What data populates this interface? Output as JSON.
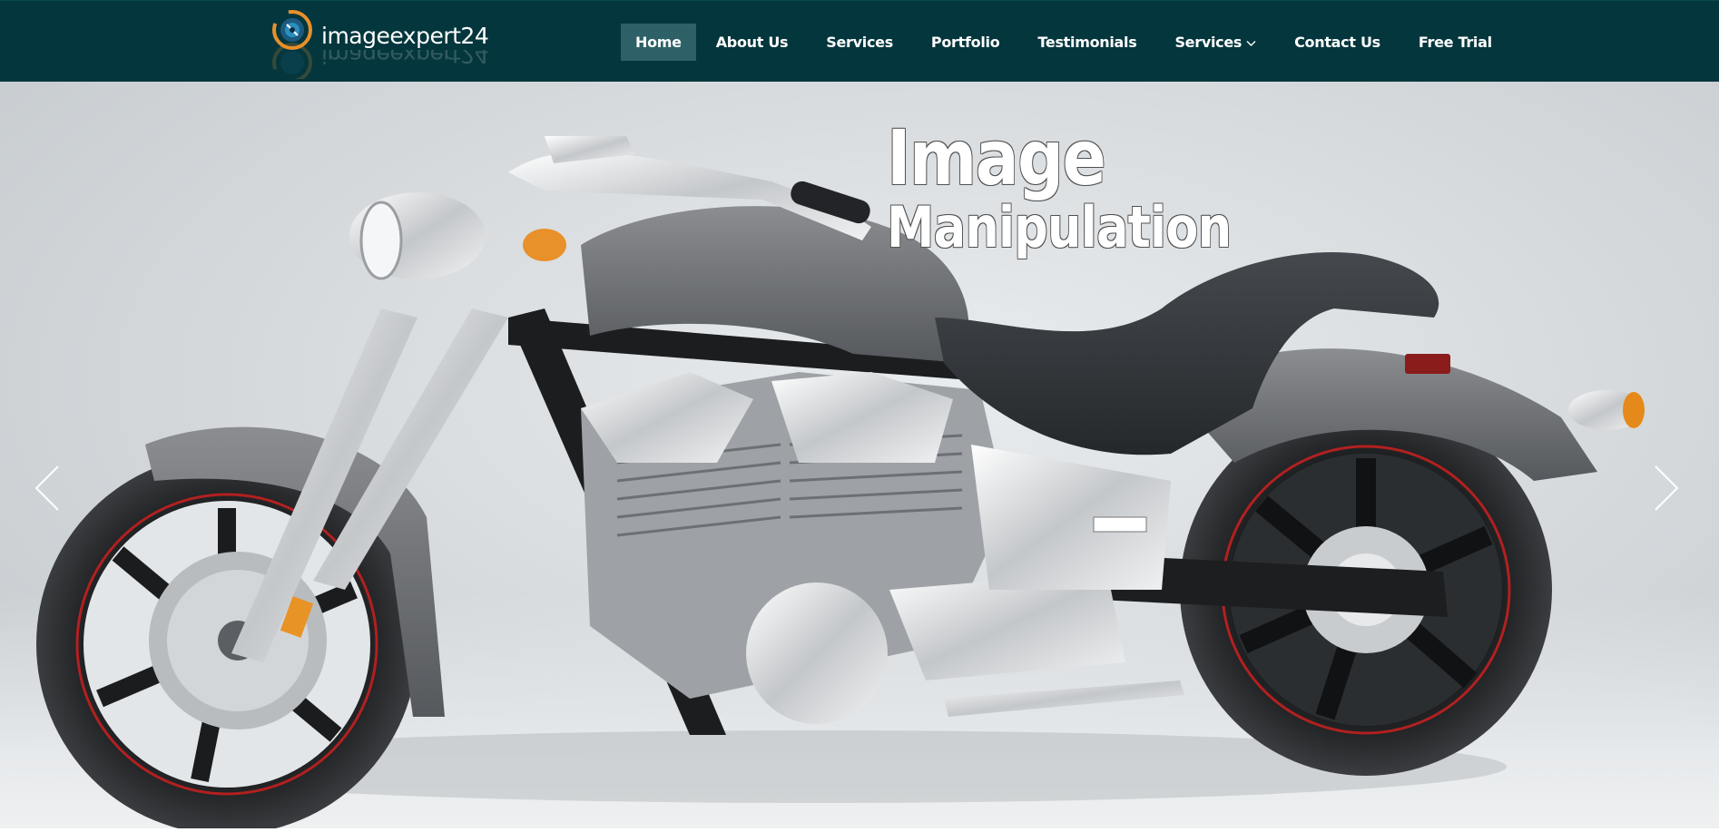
{
  "header": {
    "logo": {
      "text": "imageexpert24",
      "icon": "camera-lens-logo-icon"
    },
    "nav": [
      {
        "label": "Home",
        "active": true
      },
      {
        "label": "About Us",
        "active": false
      },
      {
        "label": "Services",
        "active": false
      },
      {
        "label": "Portfolio",
        "active": false
      },
      {
        "label": "Testimonials",
        "active": false
      },
      {
        "label": "Services",
        "active": false,
        "dropdown": true
      },
      {
        "label": "Contact Us",
        "active": false
      },
      {
        "label": "Free Trial",
        "active": false
      }
    ]
  },
  "hero": {
    "title_line1": "Image",
    "title_line2": "Manipulation",
    "image": "motorcycle-cruiser-photo",
    "prev_icon": "chevron-left-icon",
    "next_icon": "chevron-right-icon"
  },
  "colors": {
    "nav_bg": "#04363d",
    "nav_active_bg": "#2d6167",
    "logo_accent_orange": "#e8902a",
    "logo_accent_blue": "#2a8fbf"
  }
}
